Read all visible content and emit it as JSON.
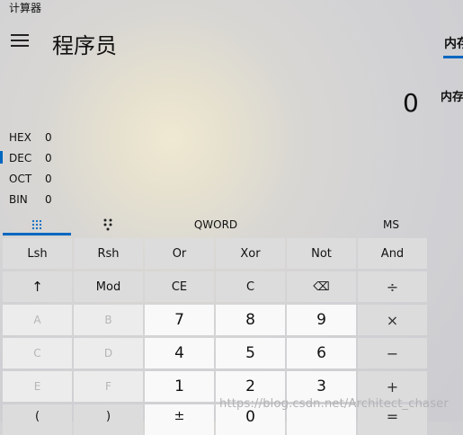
{
  "window": {
    "title": "计算器"
  },
  "header": {
    "mode": "程序员",
    "menu_icon": "hamburger-icon"
  },
  "memory": {
    "tab_label": "内存",
    "side_label": "内存"
  },
  "display": {
    "value": "0"
  },
  "bases": [
    {
      "label": "HEX",
      "value": "0"
    },
    {
      "label": "DEC",
      "value": "0"
    },
    {
      "label": "OCT",
      "value": "0"
    },
    {
      "label": "BIN",
      "value": "0"
    }
  ],
  "toolbar": {
    "keypad_icon": "keypad-grid-icon",
    "bit_icon": "bit-toggle-icon",
    "word_size": "QWORD",
    "memory_store": "MS"
  },
  "keys": {
    "row1": [
      "Lsh",
      "Rsh",
      "Or",
      "Xor",
      "Not",
      "And"
    ],
    "row2": [
      "↑",
      "Mod",
      "CE",
      "C",
      "⌫",
      "÷"
    ],
    "row3": [
      "A",
      "B",
      "7",
      "8",
      "9",
      "×"
    ],
    "row4": [
      "C",
      "D",
      "4",
      "5",
      "6",
      "−"
    ],
    "row5": [
      "E",
      "F",
      "1",
      "2",
      "3",
      "+"
    ],
    "row6": [
      "(",
      ")",
      "±",
      "0",
      "",
      "="
    ]
  },
  "watermark": "https://blog.csdn.net/Architect_chaser",
  "colors": {
    "accent": "#0067c0"
  }
}
